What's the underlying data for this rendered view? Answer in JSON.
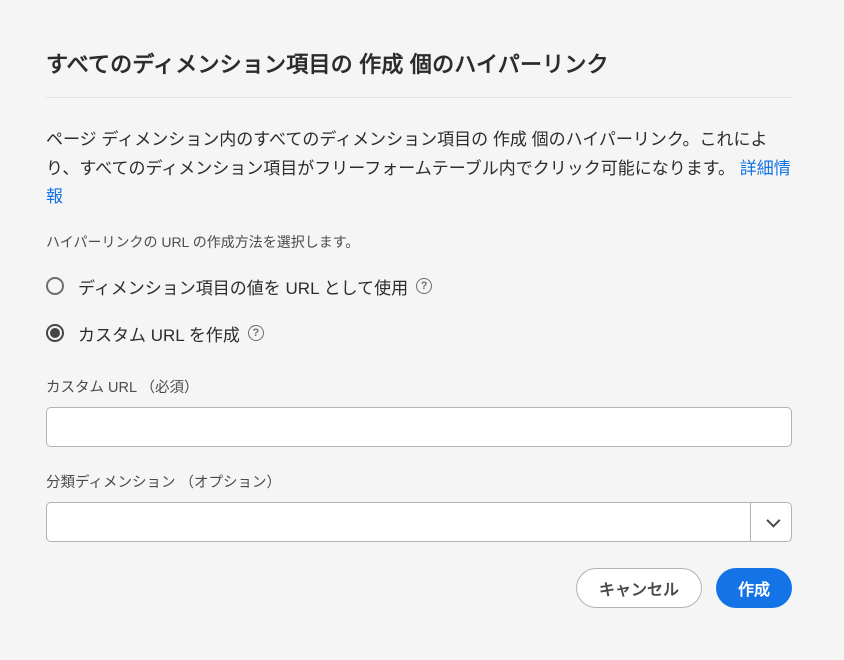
{
  "dialog": {
    "title": "すべてのディメンション項目の 作成 個のハイパーリンク",
    "description_part1": "ページ ディメンション内のすべてのディメンション項目の 作成 個のハイパーリンク。これにより、すべてのディメンション項目がフリーフォームテーブル内でクリック可能になります。",
    "more_info_label": "詳細情報",
    "subheading": "ハイパーリンクの URL の作成方法を選択します。"
  },
  "radios": {
    "use_value": {
      "label": "ディメンション項目の値を URL として使用",
      "selected": false
    },
    "custom_url": {
      "label": "カスタム URL を作成",
      "selected": true
    }
  },
  "fields": {
    "custom_url": {
      "label": "カスタム URL （必須）",
      "value": ""
    },
    "breakdown_dimension": {
      "label": "分類ディメンション （オプション）",
      "value": ""
    }
  },
  "buttons": {
    "cancel": "キャンセル",
    "create": "作成"
  },
  "help_glyph": "?"
}
